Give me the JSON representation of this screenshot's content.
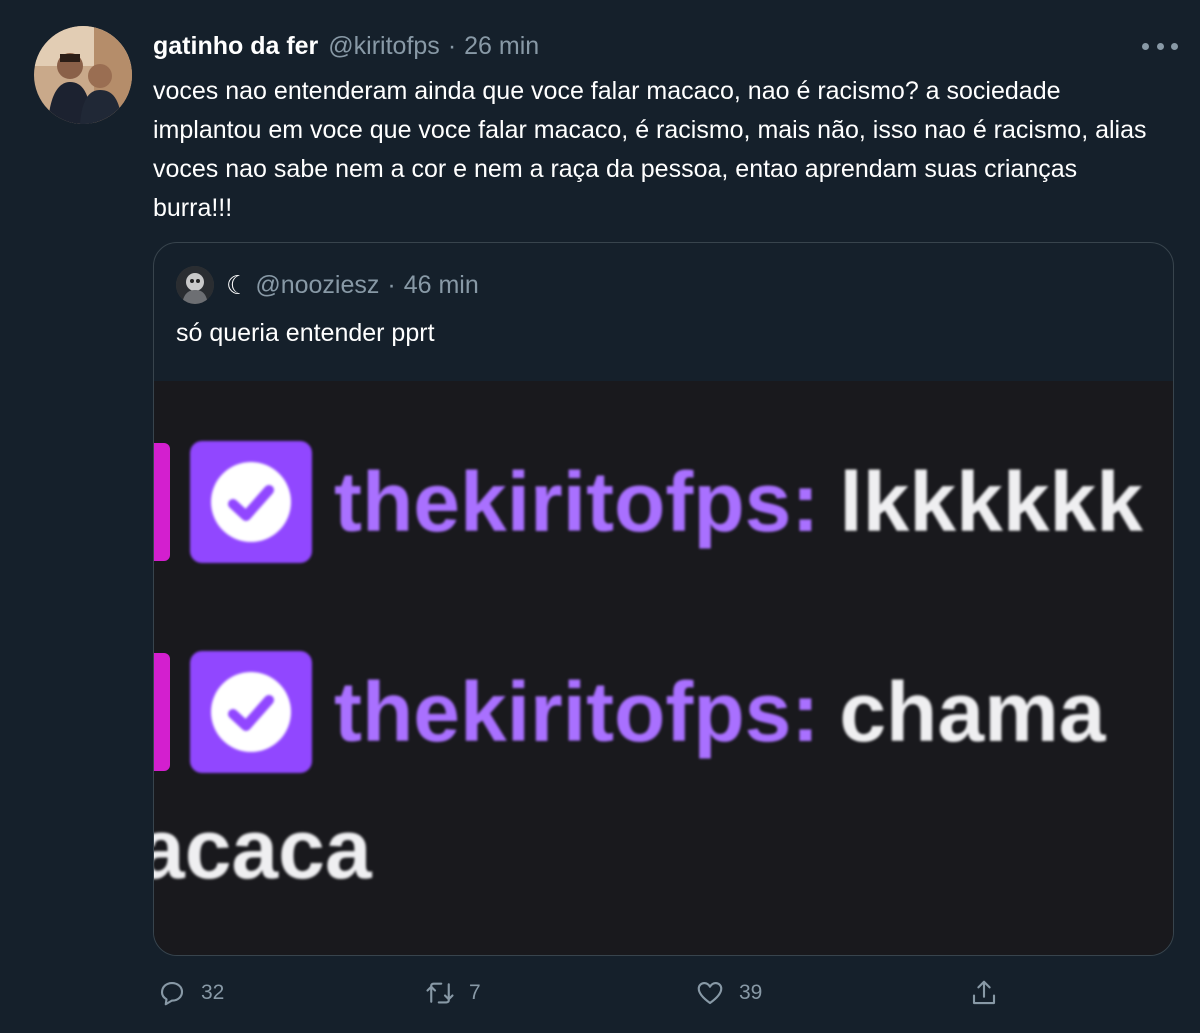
{
  "tweet": {
    "display_name": "gatinho da fer",
    "handle": "@kiritofps",
    "separator": "·",
    "time": "26 min",
    "text": "voces nao entenderam ainda que voce falar macaco, nao é racismo? a sociedade implantou em voce que voce falar macaco, é racismo, mais não, isso nao é racismo, alias voces nao sabe nem a cor e nem a raça da pessoa, entao aprendam suas crianças burra!!!"
  },
  "quote": {
    "name": "☾",
    "handle": "@nooziesz",
    "separator": "·",
    "time": "46 min",
    "text": "só queria entender pprt",
    "media": {
      "lines": [
        {
          "user": "thekiritofps:",
          "message": "lkkkkkk"
        },
        {
          "user": "thekiritofps:",
          "message": "chama"
        }
      ],
      "continuation": "acaca"
    }
  },
  "actions": {
    "reply_count": "32",
    "retweet_count": "7",
    "like_count": "39"
  },
  "colors": {
    "background": "#15202b",
    "secondary_text": "#8899a6",
    "border": "#38444d",
    "twitch_purple": "#9147ff",
    "twitch_username": "#a970ff",
    "twitch_highlight": "#d31fcf"
  }
}
